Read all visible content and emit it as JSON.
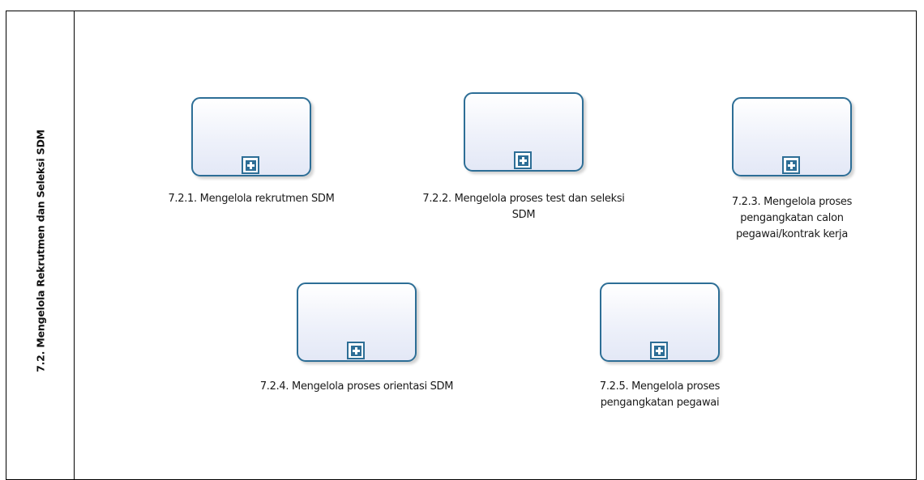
{
  "lane": {
    "title": "7.2. Mengelola Rekrutmen dan Seleksi SDM"
  },
  "tasks": [
    {
      "label": "7.2.1. Mengelola rekrutmen SDM"
    },
    {
      "label": "7.2.2. Mengelola proses test dan seleksi SDM"
    },
    {
      "label": "7.2.3. Mengelola proses pengangkatan calon pegawai/kontrak kerja"
    },
    {
      "label": "7.2.4. Mengelola proses orientasi SDM"
    },
    {
      "label": "7.2.5. Mengelola proses pengangkatan pegawai"
    }
  ],
  "colors": {
    "task_border": "#2d6e96",
    "task_fill": "#eef1fa",
    "pool_border": "#000000"
  },
  "icons": {
    "subprocess_marker": "plus-square-icon"
  }
}
